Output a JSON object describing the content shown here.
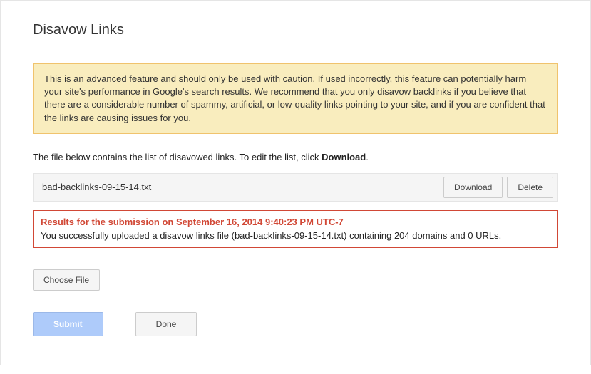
{
  "page": {
    "title": "Disavow Links"
  },
  "warning": {
    "text": "This is an advanced feature and should only be used with caution. If used incorrectly, this feature can potentially harm your site's performance in Google's search results. We recommend that you only disavow backlinks if you believe that there are a considerable number of spammy, artificial, or low-quality links pointing to your site, and if you are confident that the links are causing issues for you."
  },
  "instruction": {
    "prefix": "The file below contains the list of disavowed links. To edit the list, click ",
    "boldWord": "Download",
    "suffix": "."
  },
  "file": {
    "name": "bad-backlinks-09-15-14.txt",
    "downloadLabel": "Download",
    "deleteLabel": "Delete"
  },
  "result": {
    "header": "Results for the submission on September 16, 2014 9:40:23 PM UTC-7",
    "body": "You successfully uploaded a disavow links file (bad-backlinks-09-15-14.txt) containing 204 domains and 0 URLs."
  },
  "actions": {
    "chooseFile": "Choose File",
    "submit": "Submit",
    "done": "Done"
  }
}
